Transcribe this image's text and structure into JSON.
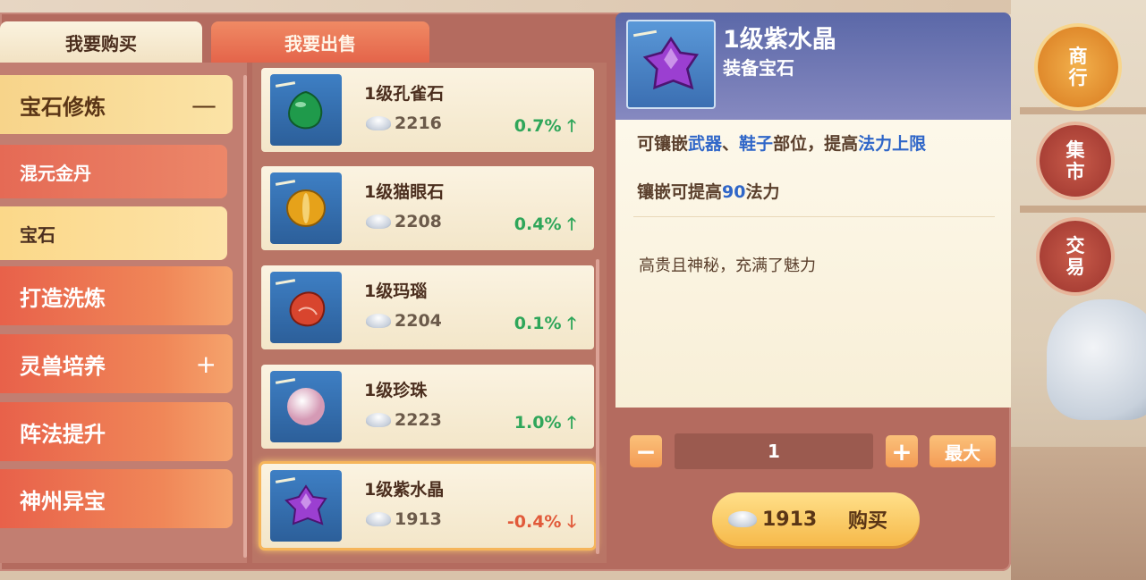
{
  "tabs": {
    "buy": "我要购买",
    "sell": "我要出售"
  },
  "categories": [
    {
      "label": "宝石修炼",
      "sign": "—",
      "state": "expanded"
    },
    {
      "label": "混元金丹",
      "type": "sub"
    },
    {
      "label": "宝石",
      "type": "sub",
      "selected": true
    },
    {
      "label": "打造洗炼"
    },
    {
      "label": "灵兽培养",
      "sign": "+"
    },
    {
      "label": "阵法提升"
    },
    {
      "label": "神州异宝"
    }
  ],
  "items": [
    {
      "name": "1级孔雀石",
      "price": "2216",
      "change": "0.7%",
      "trend": "up",
      "arrow": "🡑",
      "gem_color": "#1f9a4b"
    },
    {
      "name": "1级猫眼石",
      "price": "2208",
      "change": "0.4%",
      "trend": "up",
      "arrow": "🡑",
      "gem_color": "#e6a21a"
    },
    {
      "name": "1级玛瑙",
      "price": "2204",
      "change": "0.1%",
      "trend": "up",
      "arrow": "🡑",
      "gem_color": "#d8452e"
    },
    {
      "name": "1级珍珠",
      "price": "2223",
      "change": "1.0%",
      "trend": "up",
      "arrow": "🡑",
      "gem_color": "#eac2d2"
    },
    {
      "name": "1级紫水晶",
      "price": "1913",
      "change": "-0.4%",
      "trend": "down",
      "arrow": "🡓",
      "gem_color": "#9b3fd1"
    }
  ],
  "detail": {
    "title": "1级紫水晶",
    "subtitle": "装备宝石",
    "line1": {
      "p1": "可镶嵌",
      "h1": "武器",
      "p2": "、",
      "h2": "鞋子",
      "p3": "部位，提高",
      "h3": "法力上限"
    },
    "line2": {
      "p1": "镶嵌可提高",
      "num": "90",
      "p2": "法力"
    },
    "description": "高贵且神秘，充满了魅力"
  },
  "quantity": {
    "minus": "−",
    "value": "1",
    "plus": "+",
    "max": "最大"
  },
  "buy": {
    "price": "1913",
    "label": "购买"
  },
  "nav": [
    {
      "label": "商行",
      "active": true
    },
    {
      "label": "集市"
    },
    {
      "label": "交易"
    }
  ]
}
